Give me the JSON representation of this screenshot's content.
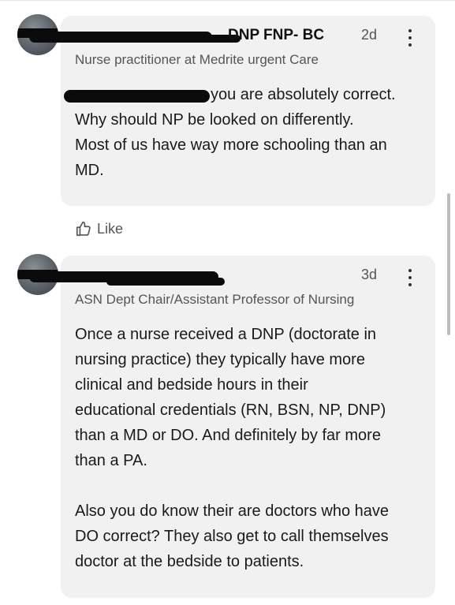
{
  "comments": [
    {
      "author_visible": "DNP FNP- BC",
      "time": "2d",
      "headline": "Nurse practitioner at Medrite urgent Care",
      "mention_tail": "you are absolutely correct.",
      "body_rest": "Why should NP be looked on differently.\nMost of us have way more schooling than an\nMD.",
      "like_label": "Like"
    },
    {
      "author_visible": "",
      "time": "3d",
      "headline": "ASN Dept Chair/Assistant Professor of Nursing",
      "body": "Once a nurse received a DNP (doctorate in\nnursing practice) they typically have more\nclinical and bedside hours in their\neducational credentials (RN, BSN, NP, DNP)\nthan a MD or DO. And definitely by far more\nthan a PA.\n\nAlso you do know their are doctors who have\nDO correct? They also get to call themselves\ndoctor at the bedside to patients."
    }
  ],
  "icons": [
    "avatar",
    "more-vertical-icon",
    "thumbs-up-icon"
  ]
}
